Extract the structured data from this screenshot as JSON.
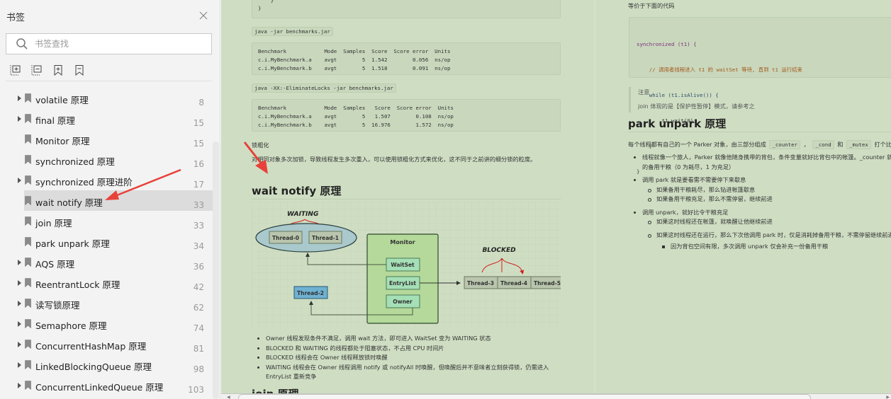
{
  "sidebar": {
    "title": "书签",
    "search_placeholder": "书签查找",
    "tools": [
      "expand-all",
      "collapse-all",
      "add-bookmark",
      "remove-bookmark"
    ],
    "items": [
      {
        "label": "volatile 原理",
        "page": "8",
        "expandable": true,
        "selected": false
      },
      {
        "label": "final 原理",
        "page": "15",
        "expandable": true,
        "selected": false
      },
      {
        "label": "Monitor 原理",
        "page": "15",
        "expandable": false,
        "selected": false
      },
      {
        "label": "synchronized 原理",
        "page": "16",
        "expandable": false,
        "selected": false
      },
      {
        "label": "synchronized 原理进阶",
        "page": "17",
        "expandable": true,
        "selected": false
      },
      {
        "label": "wait notify 原理",
        "page": "33",
        "expandable": false,
        "selected": true
      },
      {
        "label": "join 原理",
        "page": "33",
        "expandable": false,
        "selected": false
      },
      {
        "label": "park unpark 原理",
        "page": "34",
        "expandable": false,
        "selected": false
      },
      {
        "label": "AQS 原理",
        "page": "36",
        "expandable": true,
        "selected": false
      },
      {
        "label": "ReentrantLock 原理",
        "page": "42",
        "expandable": true,
        "selected": false
      },
      {
        "label": "读写锁原理",
        "page": "62",
        "expandable": true,
        "selected": false
      },
      {
        "label": "Semaphore 原理",
        "page": "74",
        "expandable": true,
        "selected": false
      },
      {
        "label": "ConcurrentHashMap 原理",
        "page": "81",
        "expandable": true,
        "selected": false
      },
      {
        "label": "LinkedBlockingQueue 原理",
        "page": "98",
        "expandable": true,
        "selected": false
      },
      {
        "label": "ConcurrentLinkedQueue 原理",
        "page": "103",
        "expandable": true,
        "selected": false
      }
    ]
  },
  "left_page": {
    "code_tail": "    }\n}",
    "cmd1": "java -jar benchmarks.jar",
    "bench1": "Benchmark            Mode  Samples  Score  Score error  Units\nc.i.MyBenchmark.a    avgt        5  1.542        0.056  ns/op\nc.i.MyBenchmark.b    avgt        5  1.518        0.091  ns/op",
    "cmd2": "java -XX:-EliminateLocks -jar benchmarks.jar",
    "bench2": "Benchmark            Mode  Samples   Score  Score error  Units\nc.i.MyBenchmark.a    avgt        5   1.507        0.108  ns/op\nc.i.MyBenchmark.b    avgt        5  16.976        1.572  ns/op",
    "lock_coarsening_title": "锁粗化",
    "lock_coarsening_text": "对相同对象多次加锁，导致线程发生多次重入，可以使用锁粗化方式来优化，这不同于之前讲的细分锁的粒度。",
    "heading": "wait notify 原理",
    "diagram": {
      "waiting_label": "WAITING",
      "blocked_label": "BLOCKED",
      "monitor_label": "Monitor",
      "waitset_label": "WaitSet",
      "entrylist_label": "EntryList",
      "owner_label": "Owner",
      "waiting_threads": [
        "Thread-0",
        "Thread-1"
      ],
      "owner_thread": "Thread-2",
      "blocked_threads": [
        "Thread-3",
        "Thread-4",
        "Thread-5"
      ]
    },
    "bullets": [
      "Owner 线程发现条件不满足，调用 wait 方法，即可进入 WaitSet 变为 WAITING 状态",
      "BLOCKED 和 WAITING 的线程都处于阻塞状态，不占用 CPU 时间片",
      "BLOCKED 线程会在 Owner 线程释放锁时唤醒",
      "WAITING 线程会在 Owner 线程调用 notify 或 notifyAll 时唤醒，但唤醒后并不意味者立刻获得锁，仍需进入",
      "EntryList 重新竞争"
    ],
    "next_heading": "join 原理"
  },
  "right_page": {
    "intro": "等价于下面的代码",
    "code": {
      "line1": "synchronized (t1) {",
      "line2": "    // 调用者线程进入 t1 的 waitSet 等待, 直到 t1 运行结束",
      "line3": "    while (t1.isAlive()) {",
      "line4": "        t1.wait(0);",
      "line5": "    }",
      "line6": "}"
    },
    "note_title": "注意",
    "note_text": "join 体现的是【保护性暂停】模式，请参考之",
    "heading": "park unpark 原理",
    "intro2_a": "每个线程都有自己的一个 Parker 对象，由三部分组成",
    "intro2_code1": "_counter",
    "intro2_sep1": "，",
    "intro2_code2": "_cond",
    "intro2_and": "和",
    "intro2_code3": "_mutex",
    "intro2_b": "打个比喻",
    "bullets": [
      {
        "level": 1,
        "text": "线程就像一个旅人，Parker 就像他随身携带的背包，条件变量就好比背包中的帐篷。_counter 就好比背包中"
      },
      {
        "level": 1,
        "text": "的备用干粮（0 为耗尽，1 为充足）",
        "cont": true
      },
      {
        "level": 1,
        "text": "调用 park 就是要看需不需要停下来歇息"
      },
      {
        "level": 2,
        "text": "如果备用干粮耗尽，那么钻进帐篷歇息"
      },
      {
        "level": 2,
        "text": "如果备用干粮充足，那么不需停留，继续前进"
      },
      {
        "level": 1,
        "text": "调用 unpark，就好比令干粮充足"
      },
      {
        "level": 2,
        "text": "如果这时线程还在帐篷，就唤醒让他继续前进"
      },
      {
        "level": 2,
        "text": "如果这时线程还在运行，那么下次他调用 park 时，仅是消耗掉备用干粮，不需停留继续前进"
      },
      {
        "level": 3,
        "text": "因为背包空间有限，多次调用 unpark 仅会补充一份备用干粮"
      }
    ]
  },
  "colors": {
    "doc_background": "#cfdec3",
    "sidebar_background": "#f3f3f3",
    "selected_item": "#dcdcdc",
    "annotation_arrow": "#e8413a",
    "fab": "#3b7ddd"
  }
}
